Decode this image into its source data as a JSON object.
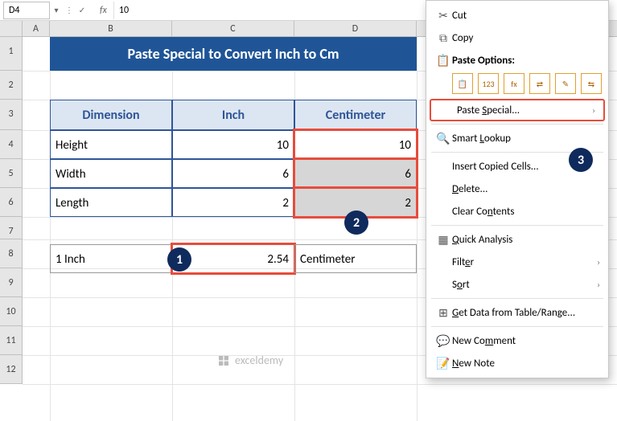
{
  "namebox": "D4",
  "formula_bar": "10",
  "columns": [
    "A",
    "B",
    "C",
    "D"
  ],
  "rows": [
    "1",
    "2",
    "3",
    "4",
    "5",
    "6",
    "7",
    "8",
    "9",
    "10",
    "11",
    "12"
  ],
  "title": "Paste Special to Convert Inch to Cm",
  "headers": {
    "dim": "Dimension",
    "inch": "Inch",
    "cm": "Centimeter"
  },
  "data": [
    {
      "dim": "Height",
      "inch": "10",
      "cm": "10"
    },
    {
      "dim": "Width",
      "inch": "6",
      "cm": "6"
    },
    {
      "dim": "Length",
      "inch": "2",
      "cm": "2"
    }
  ],
  "conv": {
    "label": "1 Inch",
    "factor": "2.54",
    "unit": "Centimeter"
  },
  "badges": {
    "b1": "1",
    "b2": "2",
    "b3": "3"
  },
  "menu": {
    "cut": "Cut",
    "copy": "Copy",
    "paste_options": "Paste Options:",
    "paste_special": "Paste Special...",
    "smart_lookup": "Smart Lookup",
    "insert_copied": "Insert Copied Cells...",
    "delete": "Delete...",
    "clear": "Clear Contents",
    "quick": "Quick Analysis",
    "filter": "Filter",
    "sort": "Sort",
    "getdata": "Get Data from Table/Range...",
    "new_comment": "New Comment",
    "new_note": "New Note"
  },
  "paste_icons": [
    "📋",
    "123",
    "fx",
    "⇄",
    "✎",
    "⇆"
  ],
  "watermark": "exceldemy"
}
